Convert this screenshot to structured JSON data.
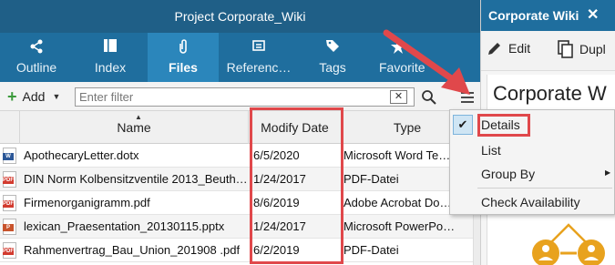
{
  "window": {
    "title": "Project Corporate_Wiki"
  },
  "tabs": [
    {
      "label": "Outline",
      "icon": "share-icon",
      "active": false
    },
    {
      "label": "Index",
      "icon": "index-icon",
      "active": false
    },
    {
      "label": "Files",
      "icon": "paperclip-icon",
      "active": true
    },
    {
      "label": "Referenc…",
      "icon": "reference-icon",
      "active": false
    },
    {
      "label": "Tags",
      "icon": "tag-icon",
      "active": false
    },
    {
      "label": "Favorite",
      "icon": "star-icon",
      "active": false
    }
  ],
  "toolbar": {
    "add_label": "Add",
    "filter_placeholder": "Enter filter",
    "clear_label": "✕"
  },
  "table": {
    "columns": [
      "Name",
      "Modify Date",
      "Type"
    ],
    "rows": [
      {
        "name": "ApothecaryLetter.dotx",
        "date": "6/5/2020",
        "type": "Microsoft Word Te…",
        "icon": "word"
      },
      {
        "name": "DIN Norm Kolbensitzventile 2013_Beuth…",
        "date": "1/24/2017",
        "type": "PDF-Datei",
        "icon": "pdf"
      },
      {
        "name": "Firmenorganigramm.pdf",
        "date": "8/6/2019",
        "type": "Adobe Acrobat Do…",
        "icon": "pdf"
      },
      {
        "name": "lexican_Praesentation_20130115.pptx",
        "date": "1/24/2017",
        "type": "Microsoft PowerPo…",
        "icon": "pptx"
      },
      {
        "name": "Rahmenvertrag_Bau_Union_201908 .pdf",
        "date": "6/2/2019",
        "type": "PDF-Datei",
        "icon": "pdf"
      }
    ]
  },
  "context_menu": {
    "items": [
      {
        "label": "Details",
        "checked": true,
        "submenu": false
      },
      {
        "label": "List",
        "checked": false,
        "submenu": false
      },
      {
        "label": "Group By",
        "checked": false,
        "submenu": true
      },
      {
        "label": "Check Availability",
        "checked": false,
        "submenu": false
      }
    ]
  },
  "right_pane": {
    "tab_label": "Corporate Wiki",
    "close_label": "✕",
    "edit_label": "Edit",
    "duplicate_label": "Dupl",
    "title": "Corporate W"
  },
  "colors": {
    "title_bar": "#1f5f87",
    "tab_bar": "#1f6e9e",
    "active_tab": "#2b86bb",
    "highlight_red": "#e0484b",
    "accent_orange": "#e8a21e"
  }
}
